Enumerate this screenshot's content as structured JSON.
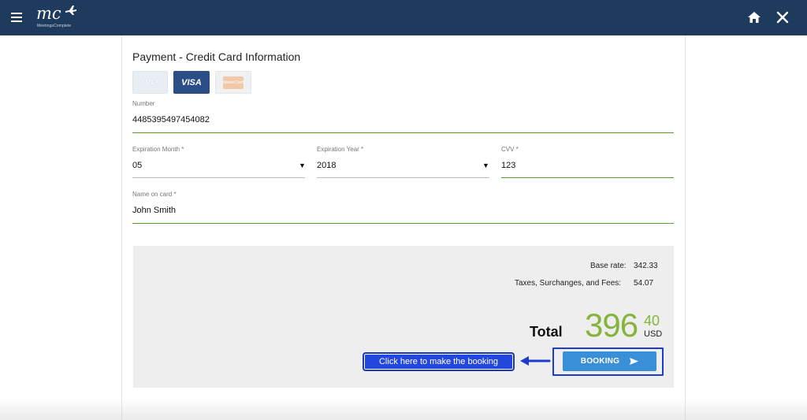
{
  "header": {
    "logo_mark": "mc",
    "logo_text": "MeetingsComplete",
    "icons": {
      "menu": "hamburger-menu-icon",
      "home": "home-icon",
      "close": "close-icon"
    },
    "bg_color": "#1e3a5c"
  },
  "payment": {
    "title": "Payment - Credit Card Information",
    "cards": [
      {
        "name": "amex",
        "label": "AMEX"
      },
      {
        "name": "visa",
        "label": "VISA",
        "selected": true
      },
      {
        "name": "mastercard",
        "label": "MasterCard"
      }
    ],
    "number": {
      "label": "Number",
      "value": "4485395497454082"
    },
    "exp_month": {
      "label": "Expiration Month *",
      "value": "05"
    },
    "exp_year": {
      "label": "Expiration Year *",
      "value": "2018"
    },
    "cvv": {
      "label": "CVV *",
      "value": "123"
    },
    "name_on_card": {
      "label": "Name on card *",
      "value": "John Smith"
    },
    "accent_color": "#5a9e2f"
  },
  "summary": {
    "base_rate_label": "Base rate:",
    "base_rate_value": "342.33",
    "taxes_label": "Taxes, Surchanges, and Fees:",
    "taxes_value": "54.07",
    "total_label": "Total",
    "total_int": "396",
    "total_dec": "40",
    "currency": "USD",
    "total_color": "#86b43a"
  },
  "booking": {
    "button_label": "BOOKING",
    "callout_text": "Click here to make the booking",
    "button_color": "#3a8fd9",
    "highlight_color": "#1d3bd0"
  }
}
